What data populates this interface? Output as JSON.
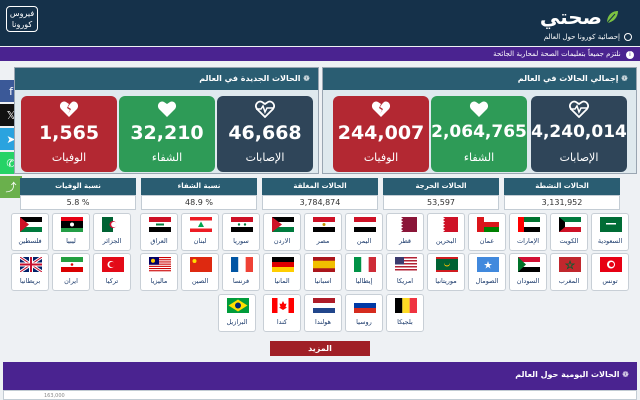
{
  "header": {
    "brand": "صحتي",
    "subtitle": "إحصائية كورونا حول العالم",
    "corona_line1": "فيروس",
    "corona_line2": "كورونا"
  },
  "notice": "نلتزم جميعاً بتعليمات الصحة لمحاربة الجائحة",
  "share": [
    {
      "label": "f",
      "color": "#3b5998"
    },
    {
      "label": "𝕏",
      "color": "#111111"
    },
    {
      "label": "➤",
      "color": "#2aa3df"
    },
    {
      "label": "✆",
      "color": "#25d366"
    },
    {
      "label": "⤴",
      "color": "#6ab04c"
    }
  ],
  "new_cases_panel": {
    "title": "❁ الحالات الجديدة في العالم",
    "cards": [
      {
        "value": "46,668",
        "label": "الإصابات",
        "icon": "heartbeat-icon"
      },
      {
        "value": "32,210",
        "label": "الشفاء",
        "icon": "heart-icon"
      },
      {
        "value": "1,565",
        "label": "الوفيات",
        "icon": "broken-heart-icon"
      }
    ]
  },
  "total_panel": {
    "title": "❁ إجمالي الحالات في العالم",
    "cards": [
      {
        "value": "4,240,014",
        "label": "الإصابات",
        "icon": "heartbeat-icon"
      },
      {
        "value": "2,064,765",
        "label": "الشفاء",
        "icon": "heart-icon"
      },
      {
        "value": "244,007",
        "label": "الوفيات",
        "icon": "broken-heart-icon"
      }
    ]
  },
  "stats": [
    {
      "label": "الحالات النشطة",
      "value": "3,131,952"
    },
    {
      "label": "الحالات الحرجة",
      "value": "53,597"
    },
    {
      "label": "الحالات المغلقة",
      "value": "3,784,874"
    },
    {
      "label": "نسبة الشفاء",
      "value": "48.9 %"
    },
    {
      "label": "نسبة الوفيات",
      "value": "5.8 %"
    }
  ],
  "flags_row1": [
    "السعودية",
    "الكويت",
    "الإمارات",
    "عمان",
    "البحرين",
    "قطر",
    "اليمن",
    "مصر",
    "الاردن",
    "سوريا",
    "لبنان",
    "العراق",
    "الجزائر",
    "ليبيا",
    "فلسطين"
  ],
  "flags_row2": [
    "تونس",
    "المغرب",
    "السودان",
    "الصومال",
    "موريتانيا",
    "امريكا",
    "إيطاليا",
    "اسبانيا",
    "المانيا",
    "فرنسا",
    "الصين",
    "ماليزيا",
    "تركيا",
    "ايران",
    "بريطانيا"
  ],
  "flags_row3": [
    "بلجيكا",
    "روسيا",
    "هولندا",
    "كندا",
    "البرازيل"
  ],
  "more_label": "المزيد",
  "daily_title": "❁ الحالات اليومية حول العالم",
  "daily_tick": "163,000",
  "colors": {
    "header": "#15314a",
    "notice": "#4a2390",
    "panel_header": "#2a5d72",
    "green": "#2e9b57",
    "red": "#b32832",
    "dark": "#2f4559"
  }
}
